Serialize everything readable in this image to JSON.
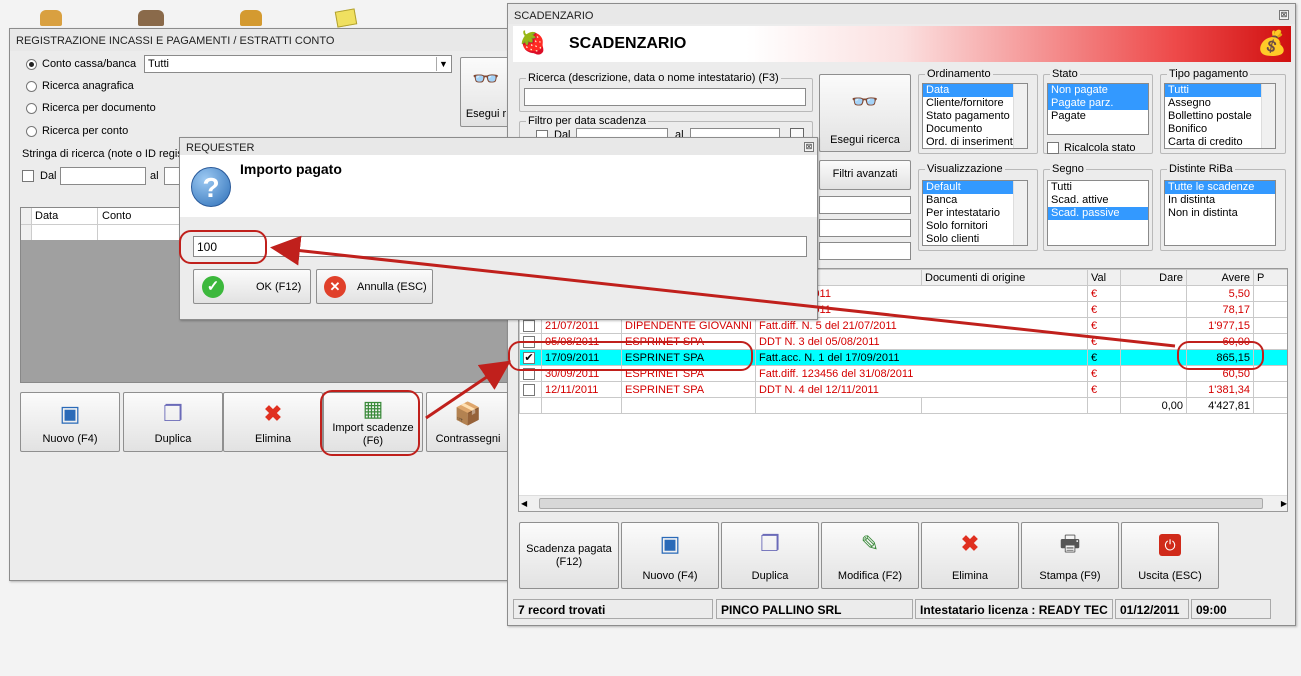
{
  "desktop": {
    "icons": [
      "users-icon",
      "group-icon",
      "person-icon",
      "notes-icon"
    ]
  },
  "reg": {
    "title": "REGISTRAZIONE INCASSI E PAGAMENTI / ESTRATTI CONTO",
    "opt_conto": "Conto cassa/banca",
    "conto_value": "Tutti",
    "opt_anagrafica": "Ricerca anagrafica",
    "opt_documento": "Ricerca per documento",
    "opt_conto2": "Ricerca per conto",
    "stringa_label": "Stringa di ricerca (note o ID regist",
    "dal": "Dal",
    "al": "al",
    "esegui": "Esegui r",
    "col_data": "Data",
    "col_conto": "Conto",
    "buttons": {
      "nuovo": "Nuovo (F4)",
      "duplica": "Duplica",
      "elimina": "Elimina",
      "import1": "Import scadenze",
      "import2": "(F6)",
      "contrassegni": "Contrassegni"
    }
  },
  "scad": {
    "title": "SCADENZARIO",
    "header": "SCADENZARIO",
    "ricerca_label": "Ricerca (descrizione, data o nome intestatario) (F3)",
    "filtro_label": "Filtro per data scadenza",
    "dal": "Dal",
    "al": "al",
    "esegui": "Esegui ricerca",
    "filtri": "Filtri avanzati",
    "ordinamento": {
      "label": "Ordinamento",
      "items": [
        "Data",
        "Cliente/fornitore",
        "Stato pagamento",
        "Documento",
        "Ord. di inserimento"
      ]
    },
    "stato": {
      "label": "Stato",
      "items": [
        "Non pagate",
        "Pagate parz.",
        "Pagate"
      ],
      "ricalcola": "Ricalcola stato"
    },
    "tipo": {
      "label": "Tipo pagamento",
      "items": [
        "Tutti",
        "Assegno",
        "Bollettino postale",
        "Bonifico",
        "Carta di credito"
      ]
    },
    "visual": {
      "label": "Visualizzazione",
      "items": [
        "Default",
        "Banca",
        "Per intestatario",
        "Solo fornitori",
        "Solo clienti"
      ]
    },
    "segno": {
      "label": "Segno",
      "items": [
        "Tutti",
        "Scad. attive",
        "Scad. passive"
      ]
    },
    "distinte": {
      "label": "Distinte RiBa",
      "items": [
        "Tutte le scadenze",
        "In distinta",
        "Non in distinta"
      ]
    },
    "cols": {
      "documenti": "Documenti di origine",
      "val": "Val",
      "dare": "Dare",
      "avere": "Avere",
      "p": "P"
    },
    "rows": [
      {
        "checked": false,
        "data": "",
        "intestatario": "",
        "doc": "del 07/06/2011",
        "val": "€",
        "dare": "",
        "avere": "5,50"
      },
      {
        "checked": false,
        "data": "",
        "intestatario": "",
        "doc": "del 09/06/2011",
        "val": "€",
        "dare": "",
        "avere": "78,17"
      },
      {
        "checked": false,
        "data": "21/07/2011",
        "intestatario": "DIPENDENTE GIOVANNI",
        "doc": "Fatt.diff. N. 5 del 21/07/2011",
        "val": "€",
        "dare": "",
        "avere": "1'977,15"
      },
      {
        "checked": false,
        "data": "05/08/2011",
        "intestatario": "ESPRINET SPA",
        "doc": "DDT N. 3 del 05/08/2011",
        "val": "€",
        "dare": "",
        "avere": "60,00"
      },
      {
        "checked": true,
        "data": "17/09/2011",
        "intestatario": "ESPRINET SPA",
        "doc": "Fatt.acc. N. 1 del 17/09/2011",
        "val": "€",
        "dare": "",
        "avere": "865,15"
      },
      {
        "checked": false,
        "data": "30/09/2011",
        "intestatario": "ESPRINET SPA",
        "doc": "Fatt.diff. 123456 del 31/08/2011",
        "val": "€",
        "dare": "",
        "avere": "60,50"
      },
      {
        "checked": false,
        "data": "12/11/2011",
        "intestatario": "ESPRINET SPA",
        "doc": "DDT N. 4 del 12/11/2011",
        "val": "€",
        "dare": "",
        "avere": "1'381,34"
      }
    ],
    "totals": {
      "dare": "0,00",
      "avere": "4'427,81"
    },
    "buttons": {
      "pagata1": "Scadenza pagata",
      "pagata2": "(F12)",
      "nuovo": "Nuovo (F4)",
      "duplica": "Duplica",
      "modifica": "Modifica (F2)",
      "elimina": "Elimina",
      "stampa": "Stampa (F9)",
      "uscita": "Uscita (ESC)"
    },
    "status": {
      "records": "7 record trovati",
      "company": "PINCO PALLINO SRL",
      "license": "Intestatario licenza : READY TEC",
      "date": "01/12/2011",
      "time": "09:00"
    }
  },
  "req": {
    "title": "REQUESTER",
    "heading": "Importo pagato",
    "value": "100",
    "ok": "OK (F12)",
    "annulla": "Annulla (ESC)"
  },
  "colors": {
    "accent": "#3399ff",
    "highlight_row": "#00ffff",
    "annotation": "#c0201c",
    "due_text": "#d40000"
  }
}
